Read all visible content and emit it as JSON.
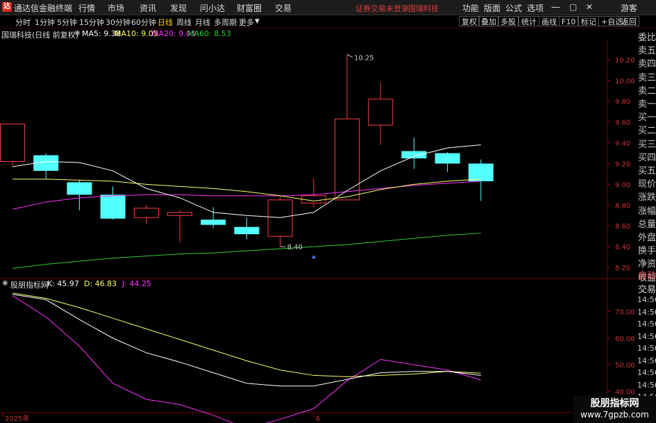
{
  "titlebar": {
    "app_name": "通达信金融终端",
    "menus": [
      "行情",
      "市场",
      "资讯",
      "发现",
      "问小达",
      "财富圈",
      "交易"
    ],
    "warning": "证券交易未登录",
    "stock": "国瑞科技",
    "right_menus": [
      "功能",
      "版面",
      "公式",
      "选项"
    ],
    "guest": "游客"
  },
  "toolbar": {
    "timeframes": [
      "分时",
      "1分钟",
      "5分钟",
      "15分钟",
      "30分钟",
      "60分钟",
      "日线",
      "周线",
      "月线",
      "多周期",
      "更多"
    ],
    "active_timeframe": "日线",
    "buttons": [
      "复权",
      "叠加",
      "多股",
      "统计",
      "画线",
      "F10",
      "标记",
      "+自选",
      "返回"
    ]
  },
  "info": {
    "title": "国瑞科技(日线 前复权)",
    "ma5": "MA5: 9.38",
    "ma10": "MA10: 9.05",
    "ma20": "MA20: 9.03",
    "ma60": "MA60: 8.53",
    "ma5_color": "#ffffff",
    "ma10_color": "#ffff66",
    "ma20_color": "#ff33ff",
    "ma60_color": "#33cc33"
  },
  "kdj_info": {
    "title": "股朋指标网",
    "k": "K: 45.97",
    "d": "D: 46.83",
    "j": "J: 44.25"
  },
  "side_panel": {
    "items": [
      "委比",
      "卖五",
      "卖四",
      "卖三",
      "卖二",
      "卖一",
      "买一",
      "买二",
      "买三",
      "买四",
      "买五",
      "现价",
      "涨跌",
      "涨幅",
      "总量",
      "外盘",
      "换手",
      "净资",
      "收益"
    ],
    "lower_items": [
      "自动",
      "交易"
    ],
    "times": [
      "14:56",
      "14:56",
      "14:56",
      "14:56",
      "14:56",
      "14:56",
      "14:56",
      "14:56",
      "14:56",
      "14:5"
    ]
  },
  "chart_data": [
    {
      "type": "candlestick",
      "y_ticks": [
        10.2,
        10.0,
        9.8,
        9.6,
        9.4,
        9.2,
        9.0,
        8.8,
        8.6,
        8.4,
        8.2
      ],
      "ylim": [
        8.1,
        10.4
      ],
      "candles": [
        {
          "open": 9.22,
          "close": 9.58,
          "high": 9.58,
          "low": 9.18
        },
        {
          "open": 9.28,
          "close": 9.13,
          "high": 9.3,
          "low": 9.05
        },
        {
          "open": 9.02,
          "close": 8.9,
          "high": 9.04,
          "low": 8.75
        },
        {
          "open": 8.9,
          "close": 8.67,
          "high": 8.98,
          "low": 8.66
        },
        {
          "open": 8.68,
          "close": 8.77,
          "high": 8.8,
          "low": 8.62
        },
        {
          "open": 8.7,
          "close": 8.73,
          "high": 8.75,
          "low": 8.44
        },
        {
          "open": 8.66,
          "close": 8.61,
          "high": 8.78,
          "low": 8.58
        },
        {
          "open": 8.59,
          "close": 8.52,
          "high": 8.68,
          "low": 8.47
        },
        {
          "open": 8.5,
          "close": 8.85,
          "high": 8.88,
          "low": 8.4
        },
        {
          "open": 8.82,
          "close": 8.89,
          "high": 9.06,
          "low": 8.78
        },
        {
          "open": 8.85,
          "close": 9.63,
          "high": 10.25,
          "low": 8.85
        },
        {
          "open": 9.57,
          "close": 9.82,
          "high": 9.98,
          "low": 9.38
        },
        {
          "open": 9.32,
          "close": 9.25,
          "high": 9.45,
          "low": 9.15
        },
        {
          "open": 9.3,
          "close": 9.2,
          "high": 9.31,
          "low": 9.12
        },
        {
          "open": 9.2,
          "close": 9.03,
          "high": 9.24,
          "low": 8.84
        }
      ],
      "annotations": [
        {
          "label": "10.25",
          "index": 10,
          "value": 10.25
        },
        {
          "label": "8.40",
          "index": 8,
          "value": 8.4
        }
      ],
      "ma5": [
        9.17,
        9.22,
        9.21,
        9.13,
        8.96,
        8.87,
        8.73,
        8.7,
        8.68,
        8.73,
        8.94,
        9.13,
        9.27,
        9.35,
        9.38
      ],
      "ma10": [
        9.05,
        9.05,
        9.04,
        9.03,
        9.0,
        8.98,
        8.96,
        8.93,
        8.89,
        8.84,
        8.88,
        8.95,
        9.0,
        9.03,
        9.05
      ],
      "ma20": [
        8.76,
        8.83,
        8.87,
        8.89,
        8.9,
        8.9,
        8.89,
        8.89,
        8.89,
        8.9,
        8.93,
        8.96,
        8.99,
        9.01,
        9.03
      ],
      "ma60": [
        8.19,
        8.23,
        8.26,
        8.29,
        8.31,
        8.33,
        8.34,
        8.36,
        8.38,
        8.4,
        8.42,
        8.45,
        8.48,
        8.51,
        8.53
      ],
      "x_labels": [
        {
          "label": "2025年",
          "index": 0
        },
        {
          "label": "6",
          "index": 9
        }
      ]
    },
    {
      "type": "line",
      "title": "股朋指标网",
      "y_ticks": [
        70.0,
        60.0,
        50.0,
        40.0
      ],
      "ylim": [
        32,
        78
      ],
      "series": [
        {
          "name": "K",
          "color": "#ffffff",
          "values": [
            76.5,
            74.5,
            67,
            60,
            54.5,
            51,
            47,
            43,
            42,
            42,
            44.5,
            47,
            47.5,
            47.5,
            45.97
          ]
        },
        {
          "name": "D",
          "color": "#ffff66",
          "values": [
            77,
            75,
            71.5,
            67.5,
            63.5,
            59.5,
            55.5,
            51.5,
            48,
            46,
            45.5,
            46,
            46.5,
            47.5,
            46.83
          ]
        },
        {
          "name": "J",
          "color": "#ff33ff",
          "values": [
            76,
            68,
            57,
            43,
            37,
            35,
            31,
            26,
            29.5,
            33.5,
            44,
            52,
            50,
            48,
            44.25
          ]
        }
      ]
    }
  ],
  "watermark": {
    "line1": "股朋指标网",
    "line2": "www.7gpzb.com"
  }
}
